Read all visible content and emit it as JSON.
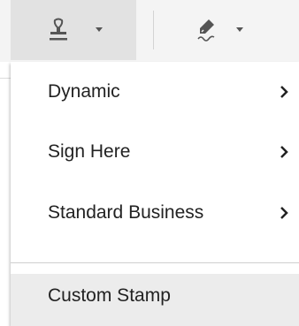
{
  "toolbar": {
    "stamp_button": {
      "icon": "stamp-icon",
      "caret": "chevron-down-icon",
      "active": true
    },
    "sign_button": {
      "icon": "signature-pen-icon",
      "caret": "chevron-down-icon"
    }
  },
  "menu": {
    "items": [
      {
        "label": "Dynamic",
        "submenu_icon": "chevron-right-icon"
      },
      {
        "label": "Sign Here",
        "submenu_icon": "chevron-right-icon"
      },
      {
        "label": "Standard Business",
        "submenu_icon": "chevron-right-icon"
      }
    ],
    "custom_stamp": {
      "label": "Custom Stamp"
    }
  },
  "colors": {
    "toolbar_bg": "#f4f4f4",
    "active_button_bg": "#e2e2e2",
    "icon": "#555555",
    "text": "#222222",
    "hover_bg": "#ececec"
  }
}
